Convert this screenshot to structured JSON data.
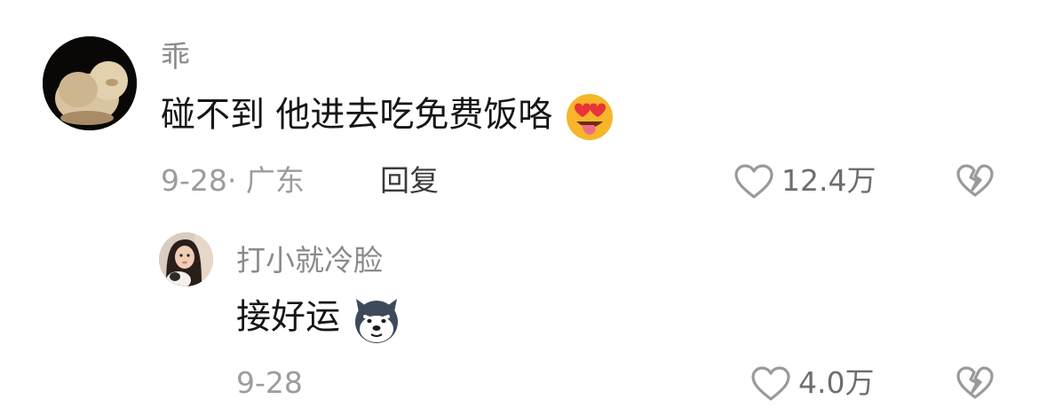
{
  "comments": [
    {
      "username": "乖",
      "text": "碰不到 他进去吃免费饭咯",
      "emoji": "heart-eyes-tongue-emoji",
      "date": "9-28",
      "separator": "·",
      "location": "广东",
      "reply_label": "回复",
      "likes": "12.4万",
      "avatar": "fluffy-cat-avatar"
    },
    {
      "username": "打小就冷脸",
      "text": "接好运",
      "emoji": "husky-dog-emoji",
      "date": "9-28",
      "likes": "4.0万",
      "avatar": "girl-with-dog-avatar"
    }
  ],
  "colors": {
    "username": "#8a8a8a",
    "comment_text": "#161616",
    "meta": "#9c9c9c",
    "icon_stroke": "#9a9a9a",
    "emoji_face": "#f7b52a",
    "emoji_heart": "#e8343a"
  }
}
